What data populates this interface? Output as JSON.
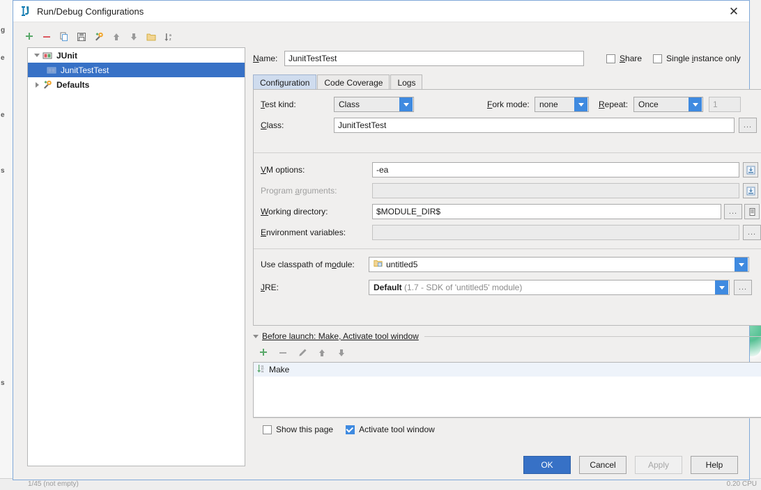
{
  "window": {
    "title": "Run/Debug Configurations",
    "app_icon": "intellij-idea-icon",
    "close_label": "✕"
  },
  "backdrop": {
    "left_fragments": [
      "g",
      "e",
      "e",
      "s",
      "s"
    ],
    "status_left": "1/45  (not empty)",
    "status_right": "0.20  CPU"
  },
  "tree_toolbar": {
    "items": [
      {
        "name": "add-configuration-button",
        "glyph": "plus"
      },
      {
        "name": "remove-configuration-button",
        "glyph": "minus"
      },
      {
        "name": "copy-configuration-button",
        "glyph": "copy"
      },
      {
        "name": "save-configuration-button",
        "glyph": "save"
      },
      {
        "name": "edit-defaults-button",
        "glyph": "wrench"
      },
      {
        "name": "move-up-button",
        "glyph": "arrow-up"
      },
      {
        "name": "move-down-button",
        "glyph": "arrow-down"
      },
      {
        "name": "create-folder-button",
        "glyph": "folder"
      },
      {
        "name": "sort-configurations-button",
        "glyph": "sort-az"
      }
    ]
  },
  "tree": {
    "nodes": [
      {
        "label": "JUnit",
        "bold": true,
        "expanded": true,
        "level": 0,
        "icon": "junit-icon",
        "selected": false
      },
      {
        "label": "JunitTestTest",
        "bold": false,
        "expanded": null,
        "level": 1,
        "icon": "junit-test-icon",
        "selected": true
      },
      {
        "label": "Defaults",
        "bold": true,
        "expanded": false,
        "level": 0,
        "icon": "wrench-icon",
        "selected": false
      }
    ]
  },
  "name_row": {
    "label": "Name:",
    "value": "JunitTestTest",
    "share": {
      "label": "Share",
      "checked": false
    },
    "single_instance": {
      "label": "Single instance only",
      "checked": false
    }
  },
  "tabs": [
    {
      "label": "Configuration",
      "active": true
    },
    {
      "label": "Code Coverage",
      "active": false
    },
    {
      "label": "Logs",
      "active": false
    }
  ],
  "configuration": {
    "test_kind": {
      "label": "Test kind:",
      "value": "Class"
    },
    "fork_mode": {
      "label": "Fork mode:",
      "value": "none"
    },
    "repeat": {
      "label": "Repeat:",
      "value": "Once",
      "count": "1",
      "count_enabled": false
    },
    "class": {
      "label": "Class:",
      "value": "JunitTestTest",
      "browse": "..."
    },
    "vm_options": {
      "label": "VM options:",
      "value": "-ea",
      "expand_icon": "expand-field-icon"
    },
    "program_arguments": {
      "label": "Program arguments:",
      "value": "",
      "enabled": false,
      "expand_icon": "expand-field-icon"
    },
    "working_directory": {
      "label": "Working directory:",
      "value": "$MODULE_DIR$",
      "browse": "...",
      "macros_icon": "macros-icon"
    },
    "environment_variables": {
      "label": "Environment variables:",
      "value": "",
      "enabled": false,
      "browse": "..."
    },
    "classpath_module": {
      "label": "Use classpath of module:",
      "value": "untitled5",
      "icon": "module-icon"
    },
    "jre": {
      "label": "JRE:",
      "value_bold": "Default",
      "value_dim": "(1.7 - SDK of 'untitled5' module)",
      "browse": "..."
    }
  },
  "before_launch": {
    "header": "Before launch: Make, Activate tool window",
    "toolbar": [
      {
        "name": "add-task-button",
        "glyph": "plus"
      },
      {
        "name": "remove-task-button",
        "glyph": "minus"
      },
      {
        "name": "edit-task-button",
        "glyph": "pencil"
      },
      {
        "name": "task-move-up-button",
        "glyph": "arrow-up"
      },
      {
        "name": "task-move-down-button",
        "glyph": "arrow-down"
      }
    ],
    "tasks": [
      {
        "label": "Make",
        "icon": "build-icon"
      }
    ],
    "show_page": {
      "label": "Show this page",
      "checked": false
    },
    "activate_tool_window": {
      "label": "Activate tool window",
      "checked": true
    }
  },
  "footer_buttons": [
    {
      "label": "OK",
      "style": "primary",
      "enabled": true,
      "name": "ok-button"
    },
    {
      "label": "Cancel",
      "style": "normal",
      "enabled": true,
      "name": "cancel-button"
    },
    {
      "label": "Apply",
      "style": "disabled",
      "enabled": false,
      "name": "apply-button"
    },
    {
      "label": "Help",
      "style": "normal",
      "enabled": true,
      "name": "help-button"
    }
  ],
  "colors": {
    "accent": "#3771c6",
    "combo_arrow": "#3f8ae0",
    "selection": "#3771c6",
    "tab_active": "#cfdcee"
  }
}
